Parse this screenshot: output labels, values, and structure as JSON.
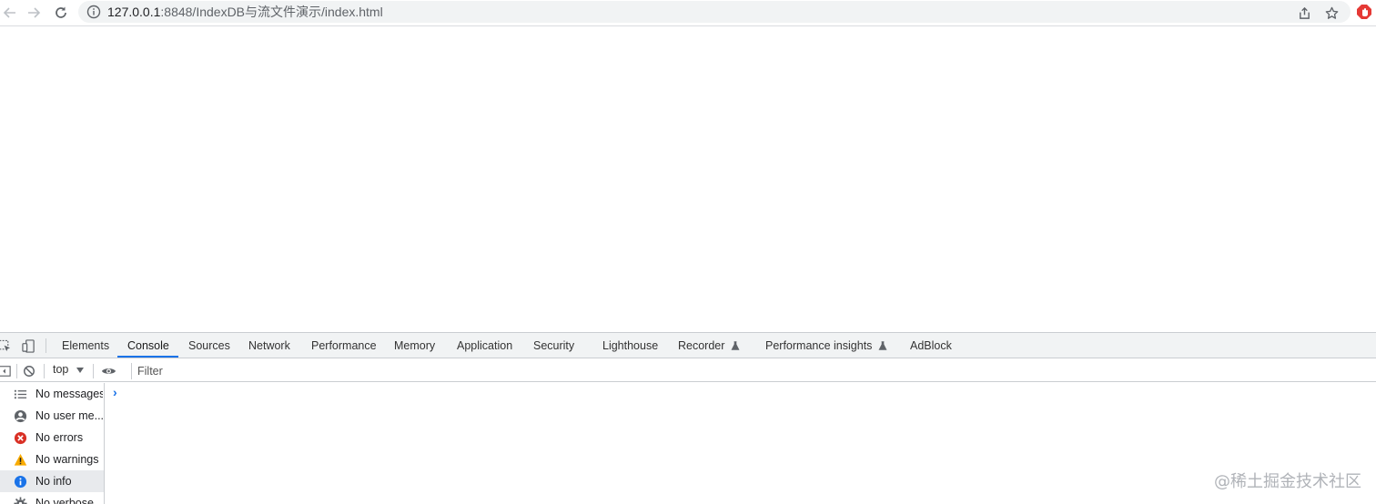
{
  "browser": {
    "url_host": "127.0.0.1",
    "url_path": ":8848/IndexDB与流文件演示/index.html"
  },
  "devtools": {
    "tabs": [
      {
        "label": "Elements"
      },
      {
        "label": "Console"
      },
      {
        "label": "Sources"
      },
      {
        "label": "Network"
      },
      {
        "label": "Performance"
      },
      {
        "label": "Memory"
      },
      {
        "label": "Application"
      },
      {
        "label": "Security"
      },
      {
        "label": "Lighthouse"
      },
      {
        "label": "Recorder"
      },
      {
        "label": "Performance insights"
      },
      {
        "label": "AdBlock"
      }
    ],
    "active_tab": "Console",
    "context": "top",
    "filter_placeholder": "Filter",
    "sidebar": [
      {
        "label": "No messages",
        "icon": "list-icon"
      },
      {
        "label": "No user me...",
        "icon": "user-icon"
      },
      {
        "label": "No errors",
        "icon": "error-icon"
      },
      {
        "label": "No warnings",
        "icon": "warning-icon"
      },
      {
        "label": "No info",
        "icon": "info-icon"
      },
      {
        "label": "No verbose",
        "icon": "gear-icon"
      }
    ],
    "selected_sidebar": "No info",
    "prompt": "›"
  },
  "colors": {
    "accent": "#1a73e8",
    "error": "#d93025",
    "warning": "#f9ab00",
    "info": "#1a73e8",
    "extension": "#e53935"
  },
  "watermark": "@稀土掘金技术社区"
}
